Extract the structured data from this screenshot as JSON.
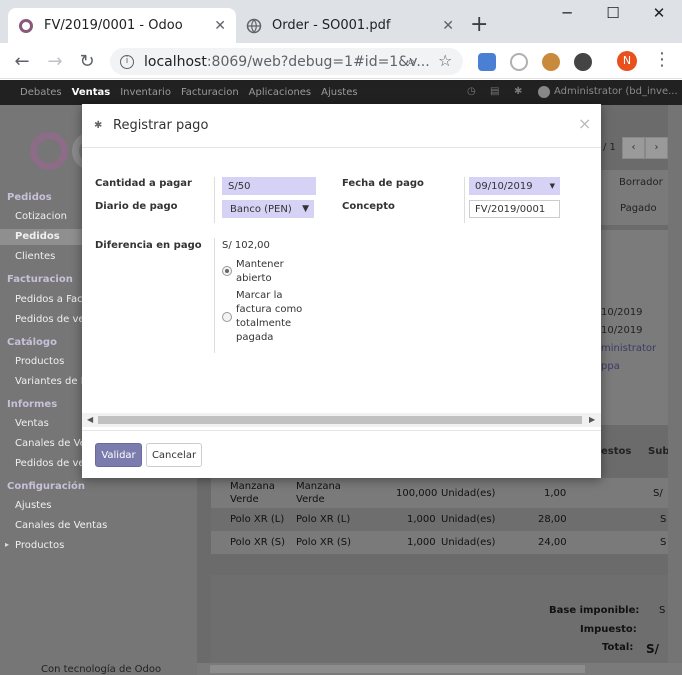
{
  "browser": {
    "tabs": [
      {
        "title": "FV/2019/0001 - Odoo",
        "close": "✕"
      },
      {
        "title": "Order - SO001.pdf",
        "close": "✕"
      }
    ],
    "new_tab": "+",
    "window": {
      "minimize": "─",
      "maximize": "☐",
      "close": "✕"
    },
    "url_host": "localhost",
    "url_rest": ":8069/web?debug=1#id=1&v...",
    "profile_initial": "N",
    "menu": "⋮"
  },
  "odoo": {
    "menu": [
      "Debates",
      "Ventas",
      "Inventario",
      "Facturacion",
      "Aplicaciones",
      "Ajustes"
    ],
    "active_menu": "Ventas",
    "user": "Administrator (bd_inve..."
  },
  "sidebar": {
    "sections": [
      {
        "title": "Pedidos",
        "items": [
          "Cotizacion",
          "Pedidos",
          "Clientes"
        ]
      },
      {
        "title": "Facturacion",
        "items": [
          "Pedidos a Fac",
          "Pedidos de ve"
        ]
      },
      {
        "title": "Catálogo",
        "items": [
          "Productos",
          "Variantes de P"
        ]
      },
      {
        "title": "Informes",
        "items": [
          "Ventas",
          "Canales de Ve",
          "Pedidos de ve"
        ]
      },
      {
        "title": "Configuración",
        "items": [
          "Ajustes",
          "Canales de Ventas",
          "Productos"
        ]
      }
    ],
    "footer": "Con tecnología de Odoo"
  },
  "background": {
    "pager": "/ 1",
    "status_draft": "Borrador",
    "status_paid": "Pagado",
    "dates": [
      "10/2019",
      "10/2019"
    ],
    "salesperson": "ministrator",
    "team": "ppa",
    "col_taxes": "estos",
    "col_subtotal": "Sub",
    "rows": [
      {
        "product": "Manzana Verde",
        "desc": "Manzana Verde",
        "qty": "100,000",
        "uom": "Unidad(es)",
        "price": "1,00",
        "tail": "S/"
      },
      {
        "product": "Polo XR (L)",
        "desc": "Polo XR (L)",
        "qty": "1,000",
        "uom": "Unidad(es)",
        "price": "28,00",
        "tail": "S"
      },
      {
        "product": "Polo XR (S)",
        "desc": "Polo XR (S)",
        "qty": "1,000",
        "uom": "Unidad(es)",
        "price": "24,00",
        "tail": "S"
      }
    ],
    "totals": [
      {
        "label": "Base imponible:",
        "value": "S"
      },
      {
        "label": "Impuesto:",
        "value": ""
      },
      {
        "label": "Total:",
        "value": "S/"
      }
    ]
  },
  "modal": {
    "title": "Registrar pago",
    "close": "×",
    "amount_label": "Cantidad a pagar",
    "amount_value": "S/50",
    "journal_label": "Diario de pago",
    "journal_value": "Banco (PEN)",
    "date_label": "Fecha de pago",
    "date_value": "09/10/2019",
    "memo_label": "Concepto",
    "memo_value": "FV/2019/0001",
    "diff_label": "Diferencia en pago",
    "diff_value": "S/ 102,00",
    "option_keep": "Mantener abierto",
    "option_mark": "Marcar la factura como totalmente pagada",
    "selected_option": "keep",
    "validate": "Validar",
    "cancel": "Cancelar"
  },
  "colors": {
    "accent": "#7c7bad",
    "required_bg": "#d6d2f5",
    "odoo_bar": "#212121"
  }
}
